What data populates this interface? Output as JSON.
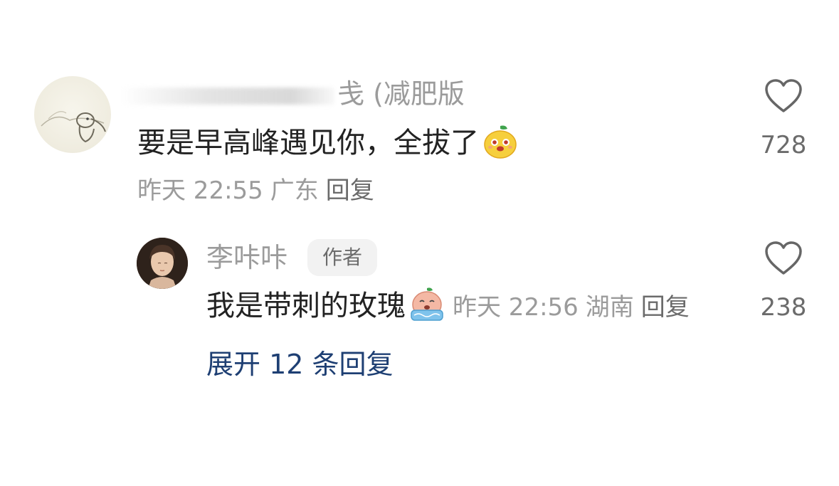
{
  "comment": {
    "username_visible": "戋 (减肥版",
    "text": "要是早高峰遇见你，全拔了",
    "time": "昨天 22:55",
    "location": "广东",
    "reply_label": "回复",
    "like_count": "728",
    "emoji_icon": "smiling-mango-emoji-icon"
  },
  "reply": {
    "username": "李咔咔",
    "author_tag": "作者",
    "text": "我是带刺的玫瑰",
    "time": "昨天 22:56",
    "location": "湖南",
    "reply_label": "回复",
    "like_count": "238",
    "emoji_icon": "crying-emoji-icon"
  },
  "expand_label": "展开 12 条回复",
  "colors": {
    "text_primary": "#222222",
    "text_secondary": "#9b9b9b",
    "link_blue": "#1e3f73",
    "tag_bg": "#f2f2f2"
  }
}
